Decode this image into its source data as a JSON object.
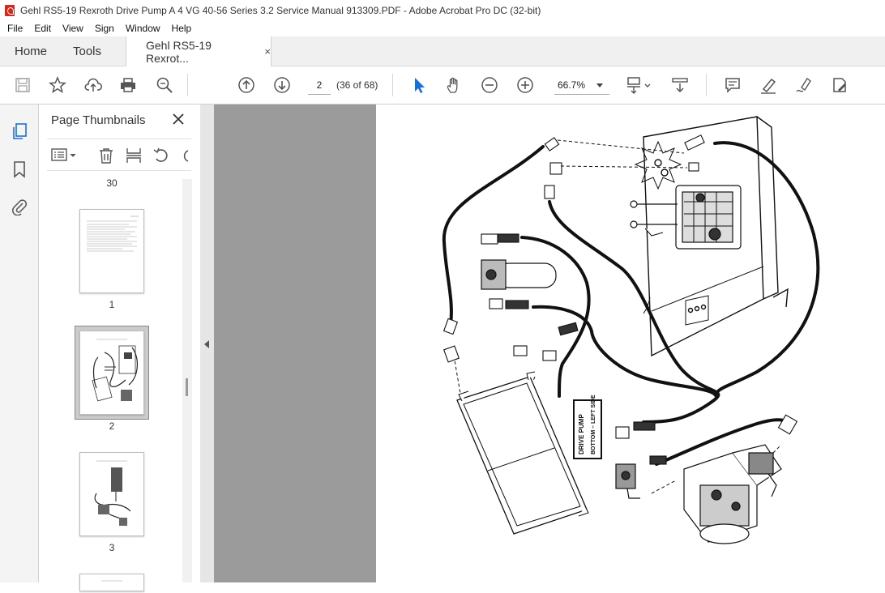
{
  "window": {
    "title": "Gehl RS5-19 Rexroth Drive Pump A 4 VG 40-56 Series 3.2 Service Manual 913309.PDF - Adobe Acrobat Pro DC (32-bit)"
  },
  "menu": [
    "File",
    "Edit",
    "View",
    "Sign",
    "Window",
    "Help"
  ],
  "tabs": {
    "home": "Home",
    "tools": "Tools",
    "document": "Gehl RS5-19 Rexrot...",
    "close": "×"
  },
  "toolbar": {
    "page_current": "2",
    "page_of": "(36 of 68)",
    "zoom": "66.7%"
  },
  "panel": {
    "title": "Page Thumbnails",
    "thumbnails": [
      {
        "label": "30"
      },
      {
        "label": "1"
      },
      {
        "label": "2",
        "selected": true
      },
      {
        "label": "3"
      }
    ]
  },
  "document": {
    "label_line1": "DRIVE PUMP",
    "label_line2": "BOTTOM – LEFT SIDE"
  },
  "icons": [
    "save-icon",
    "star-icon",
    "upload-icon",
    "print-icon",
    "search-zoom-icon",
    "page-up-icon",
    "page-down-icon",
    "cursor-icon",
    "hand-icon",
    "zoom-out-icon",
    "zoom-in-icon",
    "fit-page-icon",
    "scroll-mode-icon",
    "comment-icon",
    "highlight-icon",
    "sign-icon",
    "edit-pdf-icon"
  ]
}
